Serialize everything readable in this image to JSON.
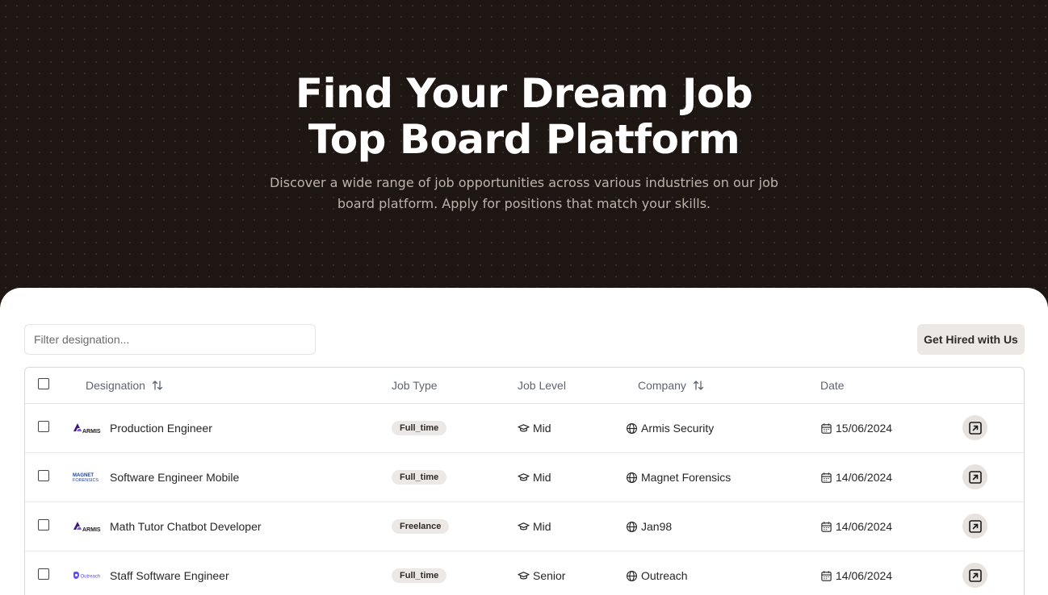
{
  "hero": {
    "title_line1": "Find Your Dream Job",
    "title_line2": "Top Board Platform",
    "subtitle": "Discover a wide range of job opportunities across various industries on our job board platform. Apply for positions that match your skills."
  },
  "toolbar": {
    "filter_placeholder": "Filter designation...",
    "hire_button_label": "Get Hired with Us"
  },
  "table": {
    "headers": {
      "designation": "Designation",
      "job_type": "Job Type",
      "job_level": "Job Level",
      "company": "Company",
      "date": "Date"
    },
    "rows": [
      {
        "logo_icon": "armis-logo-icon",
        "logo_text": "ARMIS",
        "designation": "Production Engineer",
        "job_type": "Full_time",
        "job_level": "Mid",
        "company": "Armis Security",
        "date": "15/06/2024"
      },
      {
        "logo_icon": "magnet-forensics-logo-icon",
        "logo_text": "MAGNET FORENSICS",
        "designation": "Software Engineer Mobile",
        "job_type": "Full_time",
        "job_level": "Mid",
        "company": "Magnet Forensics",
        "date": "14/06/2024"
      },
      {
        "logo_icon": "armis-logo-icon",
        "logo_text": "ARMIS",
        "designation": "Math Tutor Chatbot Developer",
        "job_type": "Freelance",
        "job_level": "Mid",
        "company": "Jan98",
        "date": "14/06/2024"
      },
      {
        "logo_icon": "outreach-logo-icon",
        "logo_text": "Outreach",
        "designation": "Staff Software Engineer",
        "job_type": "Full_time",
        "job_level": "Senior",
        "company": "Outreach",
        "date": "14/06/2024"
      }
    ]
  },
  "colors": {
    "hero_bg": "#1e1613",
    "badge_bg": "#ece8e5",
    "armis_purple": "#3b1a7a",
    "magnet_blue": "#1e3fa6",
    "outreach_purple": "#5b4bff"
  }
}
